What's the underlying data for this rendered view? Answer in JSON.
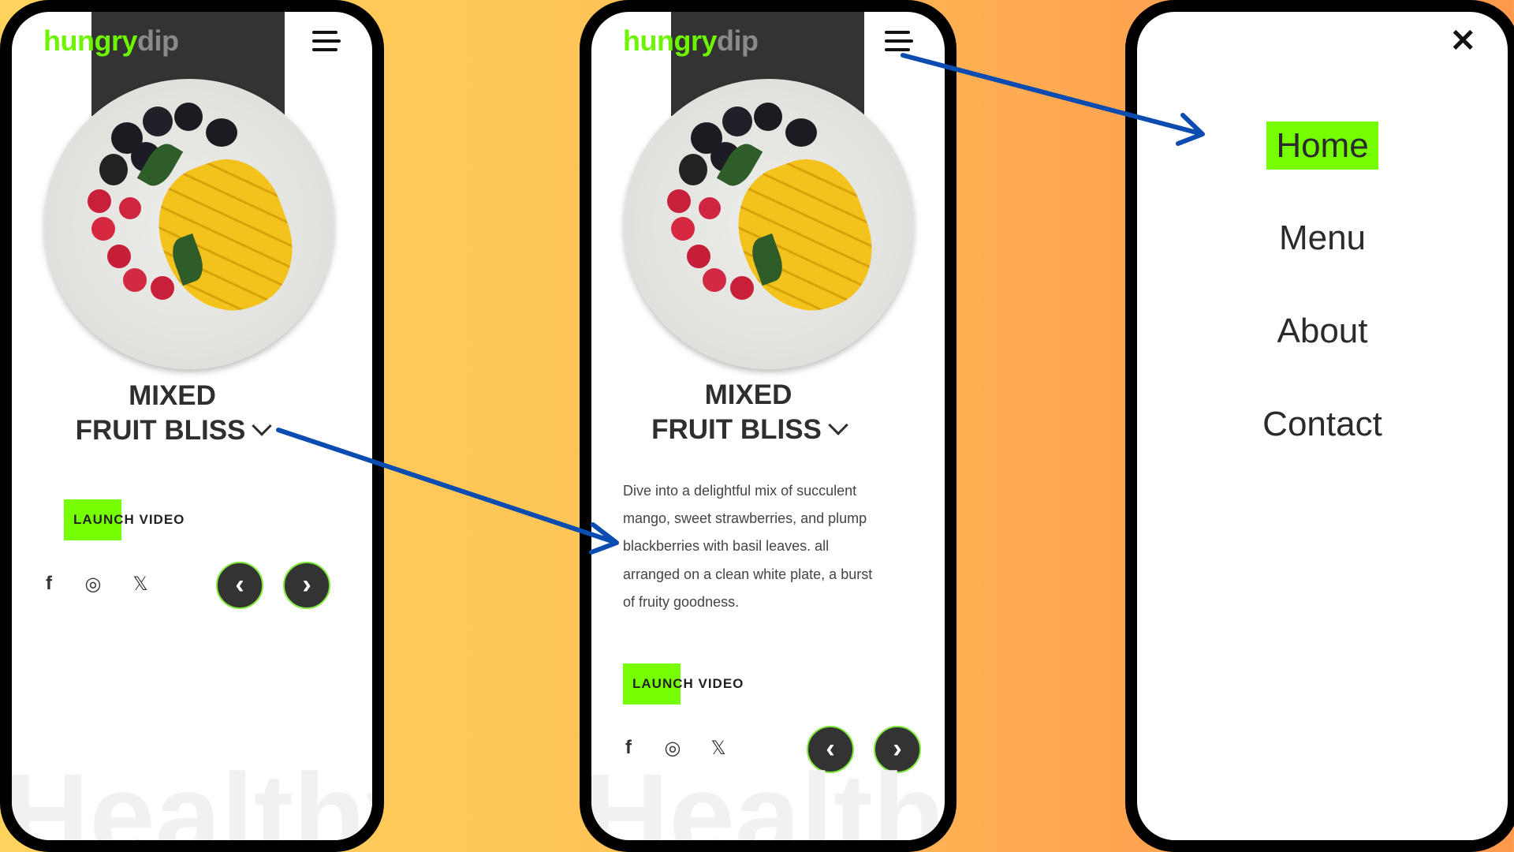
{
  "brand": {
    "part1": "hungry",
    "part2": "dip"
  },
  "product": {
    "title_line1": "MIXED",
    "title_line2": "FRUIT BLISS",
    "description": "Dive into a delightful mix of succulent mango, sweet strawberries, and plump blackberries with basil leaves. all arranged on a clean white plate, a burst of fruity goodness.",
    "launch_label": "LAUNCH VIDEO"
  },
  "social": {
    "facebook": "f",
    "instagram": "◎",
    "x": "𝕏"
  },
  "nav_buttons": {
    "prev": "‹",
    "next": "›"
  },
  "watermark": "Healthy",
  "menu": {
    "close": "✕",
    "items": [
      {
        "label": "Home",
        "active": true
      },
      {
        "label": "Menu"
      },
      {
        "label": "About"
      },
      {
        "label": "Contact"
      }
    ]
  },
  "icons": [
    "menu-icon",
    "chevron-down-icon",
    "facebook-icon",
    "instagram-icon",
    "x-icon",
    "chevron-left-icon",
    "chevron-right-icon",
    "close-icon"
  ],
  "colors": {
    "accent": "#76ff03",
    "dark": "#333333",
    "arrow": "#0a4cb0"
  }
}
